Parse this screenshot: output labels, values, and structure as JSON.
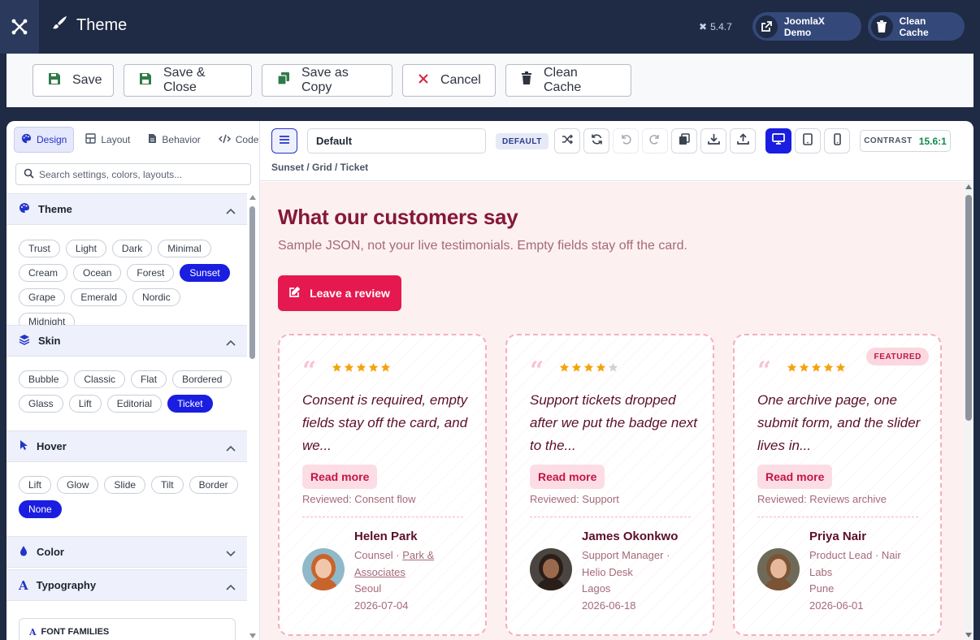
{
  "app": {
    "title": "Theme",
    "version": "5.4.7",
    "demo_label": "JoomlaX Demo",
    "cache_label": "Clean Cache"
  },
  "toolbar": {
    "save": "Save",
    "save_close": "Save & Close",
    "save_copy": "Save as Copy",
    "cancel": "Cancel",
    "clean_cache": "Clean Cache"
  },
  "tabs": [
    "Design",
    "Layout",
    "Behavior",
    "Code"
  ],
  "search": {
    "placeholder": "Search settings, colors, layouts..."
  },
  "sections": {
    "theme": {
      "title": "Theme",
      "options": [
        "Trust",
        "Light",
        "Dark",
        "Minimal",
        "Cream",
        "Ocean",
        "Forest",
        "Sunset",
        "Grape",
        "Emerald",
        "Nordic",
        "Midnight"
      ],
      "selected": "Sunset"
    },
    "skin": {
      "title": "Skin",
      "options": [
        "Bubble",
        "Classic",
        "Flat",
        "Bordered",
        "Glass",
        "Lift",
        "Editorial",
        "Ticket"
      ],
      "selected": "Ticket"
    },
    "hover": {
      "title": "Hover",
      "options": [
        "Lift",
        "Glow",
        "Slide",
        "Tilt",
        "Border",
        "None"
      ],
      "selected": "None"
    },
    "color": {
      "title": "Color"
    },
    "typography": {
      "title": "Typography",
      "font_families": "FONT FAMILIES"
    }
  },
  "preview_bar": {
    "preset": "Default",
    "badge": "DEFAULT",
    "contrast_label": "CONTRAST",
    "contrast_value": "15.6:1",
    "breadcrumb": "Sunset / Grid / Ticket"
  },
  "preview": {
    "title": "What our customers say",
    "subtitle": "Sample JSON, not your live testimonials. Empty fields stay off the card.",
    "button": "Leave a review",
    "cards": [
      {
        "stars": 5,
        "text": "Consent is required, empty fields stay off the card, and we...",
        "read_more": "Read more",
        "reviewed": "Reviewed: Consent flow",
        "name": "Helen Park",
        "role": "Counsel · ",
        "company": "Park & Associates",
        "city": "Seoul",
        "date": "2026-07-04",
        "featured": ""
      },
      {
        "stars": 4,
        "text": "Support tickets dropped after we put the badge next to the...",
        "read_more": "Read more",
        "reviewed": "Reviewed: Support",
        "name": "James Okonkwo",
        "role": "Support Manager · ",
        "company": "Helio Desk",
        "city": "Lagos",
        "date": "2026-06-18",
        "featured": ""
      },
      {
        "stars": 5,
        "text": "One archive page, one submit form, and the slider lives in...",
        "read_more": "Read more",
        "reviewed": "Reviewed: Reviews archive",
        "name": "Priya Nair",
        "role": "Product Lead · ",
        "company": "Nair Labs",
        "city": "Pune",
        "date": "2026-06-01",
        "featured": "FEATURED"
      }
    ]
  },
  "colors": {
    "accent": "#1a1ee0",
    "brand": "#e5194f",
    "title": "#851838",
    "star": "#f5a30b",
    "star_empty": "#cfd3da"
  }
}
